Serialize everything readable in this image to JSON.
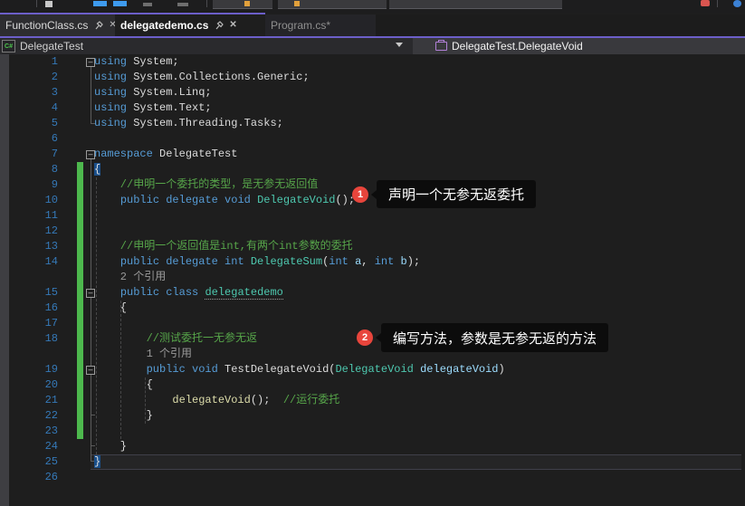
{
  "colors": {
    "accent_purple": "#6C5FC9",
    "editor_bg": "#1E1E1E",
    "keyword": "#569CD6",
    "type": "#4EC9B0",
    "comment": "#57A64A",
    "parameter": "#9CDCFE",
    "line_number": "#3579B8",
    "change_bar_green": "#4DB84D",
    "brace_match_bg": "#1A4F8A",
    "annotation_red": "#E8453C",
    "annotation_box_bg": "#0C0C0C"
  },
  "icons": {
    "csharp_label": "C#"
  },
  "tabs": [
    {
      "label": "FunctionClass.cs",
      "active": false
    },
    {
      "label": "delegatedemo.cs",
      "active": true
    },
    {
      "label": "Program.cs*",
      "active": false
    }
  ],
  "breadcrumb": {
    "project": "DelegateTest",
    "member": "DelegateTest.DelegateVoid"
  },
  "annotations": [
    {
      "number": "1",
      "text": "声明一个无参无返委托"
    },
    {
      "number": "2",
      "text": "编写方法，参数是无参无返的方法"
    }
  ],
  "editor": {
    "rows": [
      {
        "n": "1",
        "t": [
          [
            "k",
            "using"
          ],
          [
            "d",
            " System;"
          ]
        ]
      },
      {
        "n": "2",
        "t": [
          [
            "k",
            "using"
          ],
          [
            "d",
            " System.Collections.Generic;"
          ]
        ]
      },
      {
        "n": "3",
        "t": [
          [
            "k",
            "using"
          ],
          [
            "d",
            " System.Linq;"
          ]
        ]
      },
      {
        "n": "4",
        "t": [
          [
            "k",
            "using"
          ],
          [
            "d",
            " System.Text;"
          ]
        ]
      },
      {
        "n": "5",
        "t": [
          [
            "k",
            "using"
          ],
          [
            "d",
            " System.Threading.Tasks;"
          ]
        ]
      },
      {
        "n": "6",
        "t": []
      },
      {
        "n": "7",
        "t": [
          [
            "k",
            "namespace"
          ],
          [
            "d",
            " DelegateTest"
          ]
        ]
      },
      {
        "n": "8",
        "t": [
          [
            "d hl",
            "{"
          ]
        ]
      },
      {
        "n": "9",
        "t": [
          [
            "c",
            "    //申明一个委托的类型，是无参无返回值"
          ]
        ]
      },
      {
        "n": "10",
        "t": [
          [
            "d",
            "    "
          ],
          [
            "k",
            "public"
          ],
          [
            "d",
            " "
          ],
          [
            "k",
            "delegate"
          ],
          [
            "d",
            " "
          ],
          [
            "k",
            "void"
          ],
          [
            "d",
            " "
          ],
          [
            "t",
            "DelegateVoid"
          ],
          [
            "d",
            "();"
          ]
        ]
      },
      {
        "n": "11",
        "t": []
      },
      {
        "n": "12",
        "t": []
      },
      {
        "n": "13",
        "t": [
          [
            "c",
            "    //申明一个返回值是int,有两个int参数的委托"
          ]
        ]
      },
      {
        "n": "14",
        "t": [
          [
            "d",
            "    "
          ],
          [
            "k",
            "public"
          ],
          [
            "d",
            " "
          ],
          [
            "k",
            "delegate"
          ],
          [
            "d",
            " "
          ],
          [
            "k",
            "int"
          ],
          [
            "d",
            " "
          ],
          [
            "t",
            "DelegateSum"
          ],
          [
            "d",
            "("
          ],
          [
            "k",
            "int"
          ],
          [
            "d",
            " "
          ],
          [
            "p",
            "a"
          ],
          [
            "d",
            ", "
          ],
          [
            "k",
            "int"
          ],
          [
            "d",
            " "
          ],
          [
            "p",
            "b"
          ],
          [
            "d",
            ");"
          ]
        ]
      },
      {
        "cl": true,
        "t": [
          [
            "n",
            "    2 个引用"
          ]
        ]
      },
      {
        "n": "15",
        "t": [
          [
            "d",
            "    "
          ],
          [
            "k",
            "public"
          ],
          [
            "d",
            " "
          ],
          [
            "k",
            "class"
          ],
          [
            "d",
            " "
          ],
          [
            "t sug",
            "delegatedemo"
          ]
        ]
      },
      {
        "n": "16",
        "t": [
          [
            "d",
            "    {"
          ]
        ]
      },
      {
        "n": "17",
        "t": []
      },
      {
        "n": "18",
        "t": [
          [
            "c",
            "        //测试委托一无参无返"
          ]
        ]
      },
      {
        "cl": true,
        "t": [
          [
            "n",
            "        1 个引用"
          ]
        ]
      },
      {
        "n": "19",
        "t": [
          [
            "d",
            "        "
          ],
          [
            "k",
            "public"
          ],
          [
            "d",
            " "
          ],
          [
            "k",
            "void"
          ],
          [
            "d",
            " "
          ],
          [
            "m",
            "TestDelegateVoid"
          ],
          [
            "d",
            "("
          ],
          [
            "t",
            "DelegateVoid"
          ],
          [
            "d",
            " "
          ],
          [
            "p",
            "delegateVoid"
          ],
          [
            "d",
            ")"
          ]
        ]
      },
      {
        "n": "20",
        "t": [
          [
            "d",
            "        {"
          ]
        ]
      },
      {
        "n": "21",
        "t": [
          [
            "d",
            "            "
          ],
          [
            "y",
            "delegateVoid"
          ],
          [
            "d",
            "();  "
          ],
          [
            "c",
            "//运行委托"
          ]
        ]
      },
      {
        "n": "22",
        "t": [
          [
            "d",
            "        }"
          ]
        ]
      },
      {
        "n": "23",
        "t": []
      },
      {
        "n": "24",
        "t": [
          [
            "d",
            "    }"
          ]
        ]
      },
      {
        "n": "25",
        "cur": true,
        "t": [
          [
            "d hl",
            "}"
          ]
        ]
      },
      {
        "n": "26",
        "t": []
      }
    ]
  }
}
